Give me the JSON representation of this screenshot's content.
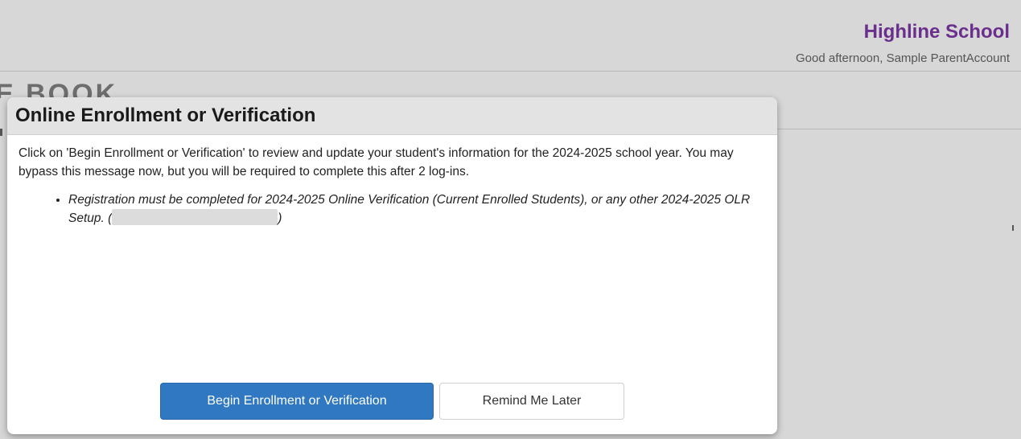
{
  "header": {
    "school_name": "Highline School",
    "greeting": "Good afternoon, Sample ParentAccount"
  },
  "background": {
    "page_title_fragment": "E BOOK"
  },
  "modal": {
    "title": "Online Enrollment or Verification",
    "intro": "Click on 'Begin Enrollment or Verification' to review and update your student's information for the 2024-2025 school year. You may bypass this message now, but you will be required to complete this after 2 log-ins.",
    "notice_text": "Registration must be completed for 2024-2025 Online Verification (Current Enrolled Students), or any other 2024-2025 OLR Setup. (",
    "notice_close": ")",
    "buttons": {
      "begin": "Begin Enrollment or Verification",
      "remind": "Remind Me Later"
    }
  },
  "colors": {
    "brand_purple": "#6a2f8c",
    "primary_button": "#3079c2",
    "page_background": "#d7d7d7"
  }
}
